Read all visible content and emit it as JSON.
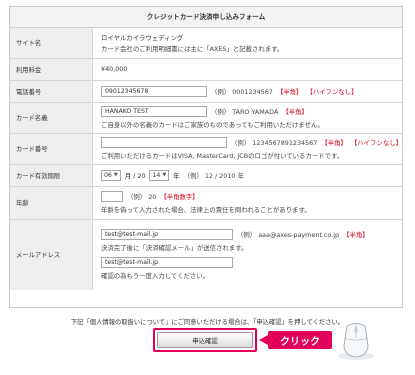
{
  "form": {
    "title": "クレジットカード決済申し込みフォーム",
    "rows": {
      "site": {
        "label": "サイト名",
        "name": "ロイヤルカイラウェディング",
        "note": "カード会社のご利用明細書には主に「AXES」と記載されます。"
      },
      "amount": {
        "label": "利用料金",
        "value": "¥40,000"
      },
      "phone": {
        "label": "電話番号",
        "value": "09012345678",
        "example": "（例） 0001234567",
        "req1": "【半角】",
        "req2": "【ハイフンなし】"
      },
      "card_name": {
        "label": "カード名義",
        "value": "HANAKO TEST",
        "example": "（例） TARO YAMADA",
        "req1": "【半角】",
        "note": "ご自身以外の名義のカードはご家族のものであってもご利用いただけません。"
      },
      "card_number": {
        "label": "カード番号",
        "value": "",
        "example": "（例） 1234567891234567",
        "req1": "【半角】",
        "req2": "【ハイフンなし】",
        "note": "ご利用いただけるカードはVISA, MasterCard, JCBのロゴが付いているカードです。"
      },
      "expiry": {
        "label": "カード有効期限",
        "month": "06",
        "month_unit": "月 / 20",
        "year": "14",
        "year_unit": "年",
        "example": "（例） 12 / 2010 年"
      },
      "age": {
        "label": "年齢",
        "value": "",
        "example": "（例） 20",
        "req1": "【半角数字】",
        "note": "年齢を偽って入力された場合、法律上の責任を問われることがあります。"
      },
      "email": {
        "label": "メールアドレス",
        "value": "test@test-mail.jp",
        "example": "（例） aaa@axes-payment.co.jp",
        "req1": "【半角】",
        "note1": "決済完了後に「決済確認メール」が送信されます。",
        "confirm_value": "test@test-mail.jp",
        "note2": "確認の為もう一度入力してください。"
      }
    }
  },
  "footer": {
    "notice": "下記「個人情報の取扱いについて」にご同意いただける場合は、「申込確認」を押してください。",
    "submit_label": "申込確認",
    "callout_label": "クリック"
  },
  "colors": {
    "accent": "#e2005a",
    "required": "#d8001c",
    "label_bg": "#eeeeee"
  }
}
